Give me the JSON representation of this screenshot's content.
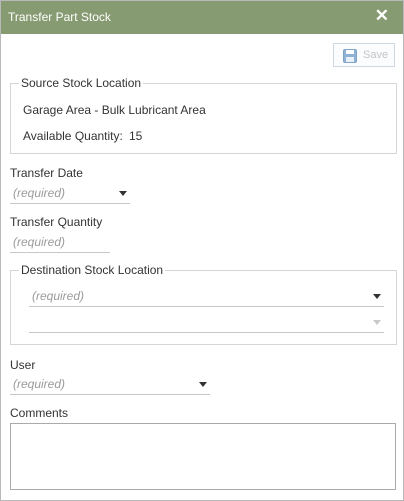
{
  "dialog": {
    "title": "Transfer Part Stock",
    "close_glyph": "✕",
    "save_label": "Save",
    "save_icon": "floppy-disk-icon"
  },
  "source": {
    "legend": "Source Stock Location",
    "location": "Garage Area - Bulk Lubricant Area",
    "available_label": "Available Quantity:",
    "available_value": "15"
  },
  "transfer_date": {
    "label": "Transfer Date",
    "placeholder": "(required)"
  },
  "transfer_quantity": {
    "label": "Transfer Quantity",
    "placeholder": "(required)"
  },
  "destination": {
    "legend": "Destination Stock Location",
    "placeholder": "(required)",
    "second_value": ""
  },
  "user": {
    "label": "User",
    "placeholder": "(required)"
  },
  "comments": {
    "label": "Comments",
    "value": ""
  },
  "colors": {
    "header": "#879b72",
    "save_icon": "#7fa4c8"
  }
}
